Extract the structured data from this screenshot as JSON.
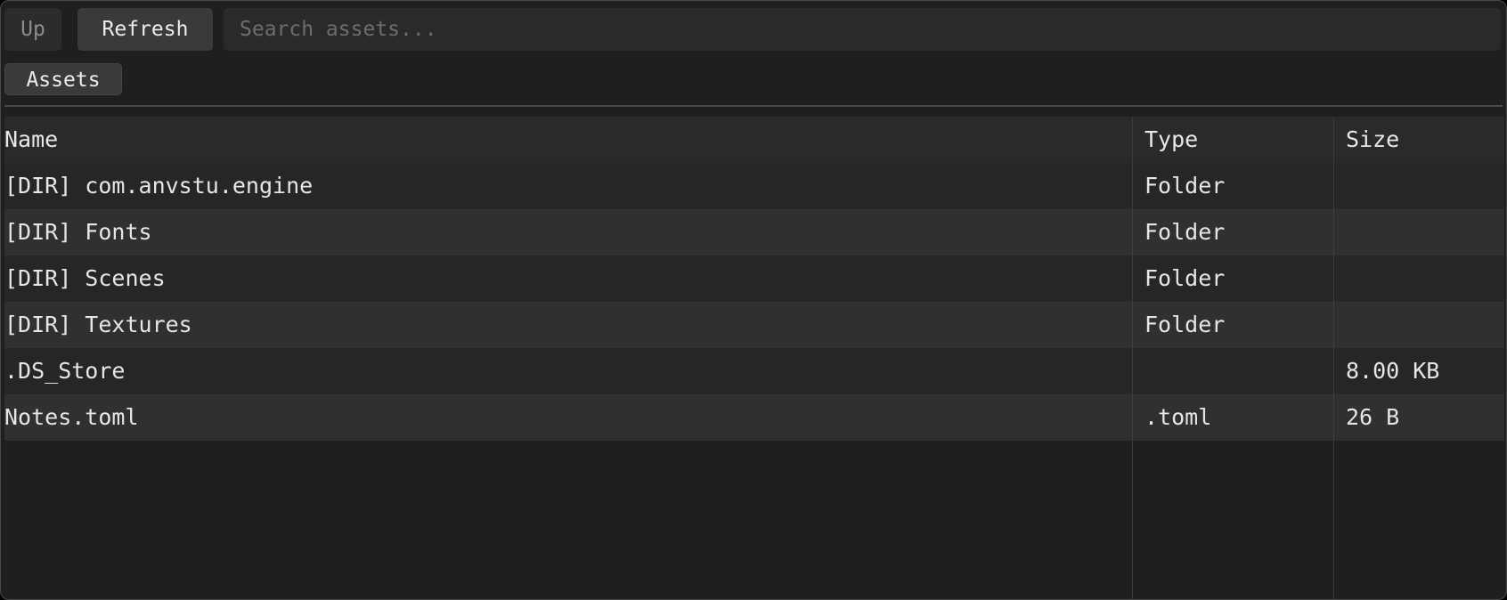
{
  "toolbar": {
    "up_label": "Up",
    "refresh_label": "Refresh",
    "search_placeholder": "Search assets...",
    "search_value": ""
  },
  "breadcrumb": {
    "items": [
      "Assets"
    ]
  },
  "table": {
    "columns": [
      "Name",
      "Type",
      "Size"
    ],
    "rows": [
      {
        "name": "[DIR] com.anvstu.engine",
        "type": "Folder",
        "size": ""
      },
      {
        "name": "[DIR] Fonts",
        "type": "Folder",
        "size": ""
      },
      {
        "name": "[DIR] Scenes",
        "type": "Folder",
        "size": ""
      },
      {
        "name": "[DIR] Textures",
        "type": "Folder",
        "size": ""
      },
      {
        "name": ".DS_Store",
        "type": "",
        "size": "8.00 KB"
      },
      {
        "name": "Notes.toml",
        "type": ".toml",
        "size": "26 B"
      }
    ]
  },
  "colors": {
    "background": "#1f1f1f",
    "row_dark": "#262626",
    "row_light": "#303030",
    "header": "#2a2a2a",
    "text": "#e6e6e6"
  }
}
